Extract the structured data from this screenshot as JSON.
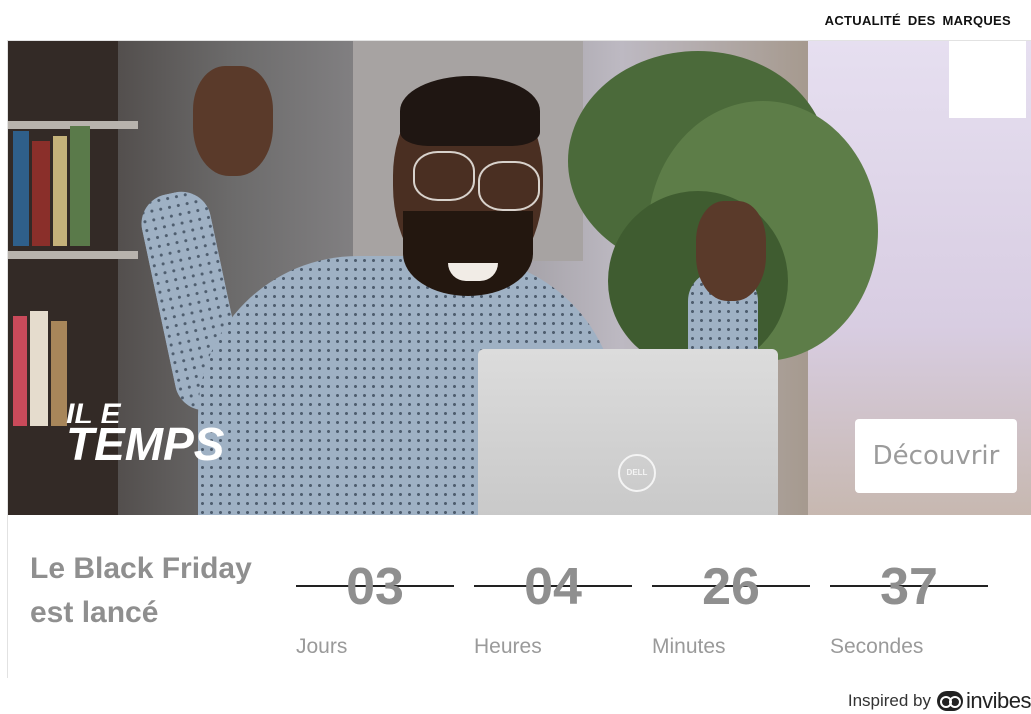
{
  "header": {
    "brand_news_label": "ACTUALITÉ DES MARQUES"
  },
  "ad": {
    "video": {
      "slogan_line1": "IL E",
      "slogan_line2": "TEMPS",
      "laptop_logo": "DELL"
    },
    "cta_label": "Découvrir",
    "headline": "Le Black Friday est lancé",
    "countdown": [
      {
        "value": "03",
        "unit": "Jours"
      },
      {
        "value": "04",
        "unit": "Heures"
      },
      {
        "value": "26",
        "unit": "Minutes"
      },
      {
        "value": "37",
        "unit": "Secondes"
      }
    ]
  },
  "footer": {
    "inspired_by": "Inspired by",
    "brand": "invibes"
  }
}
